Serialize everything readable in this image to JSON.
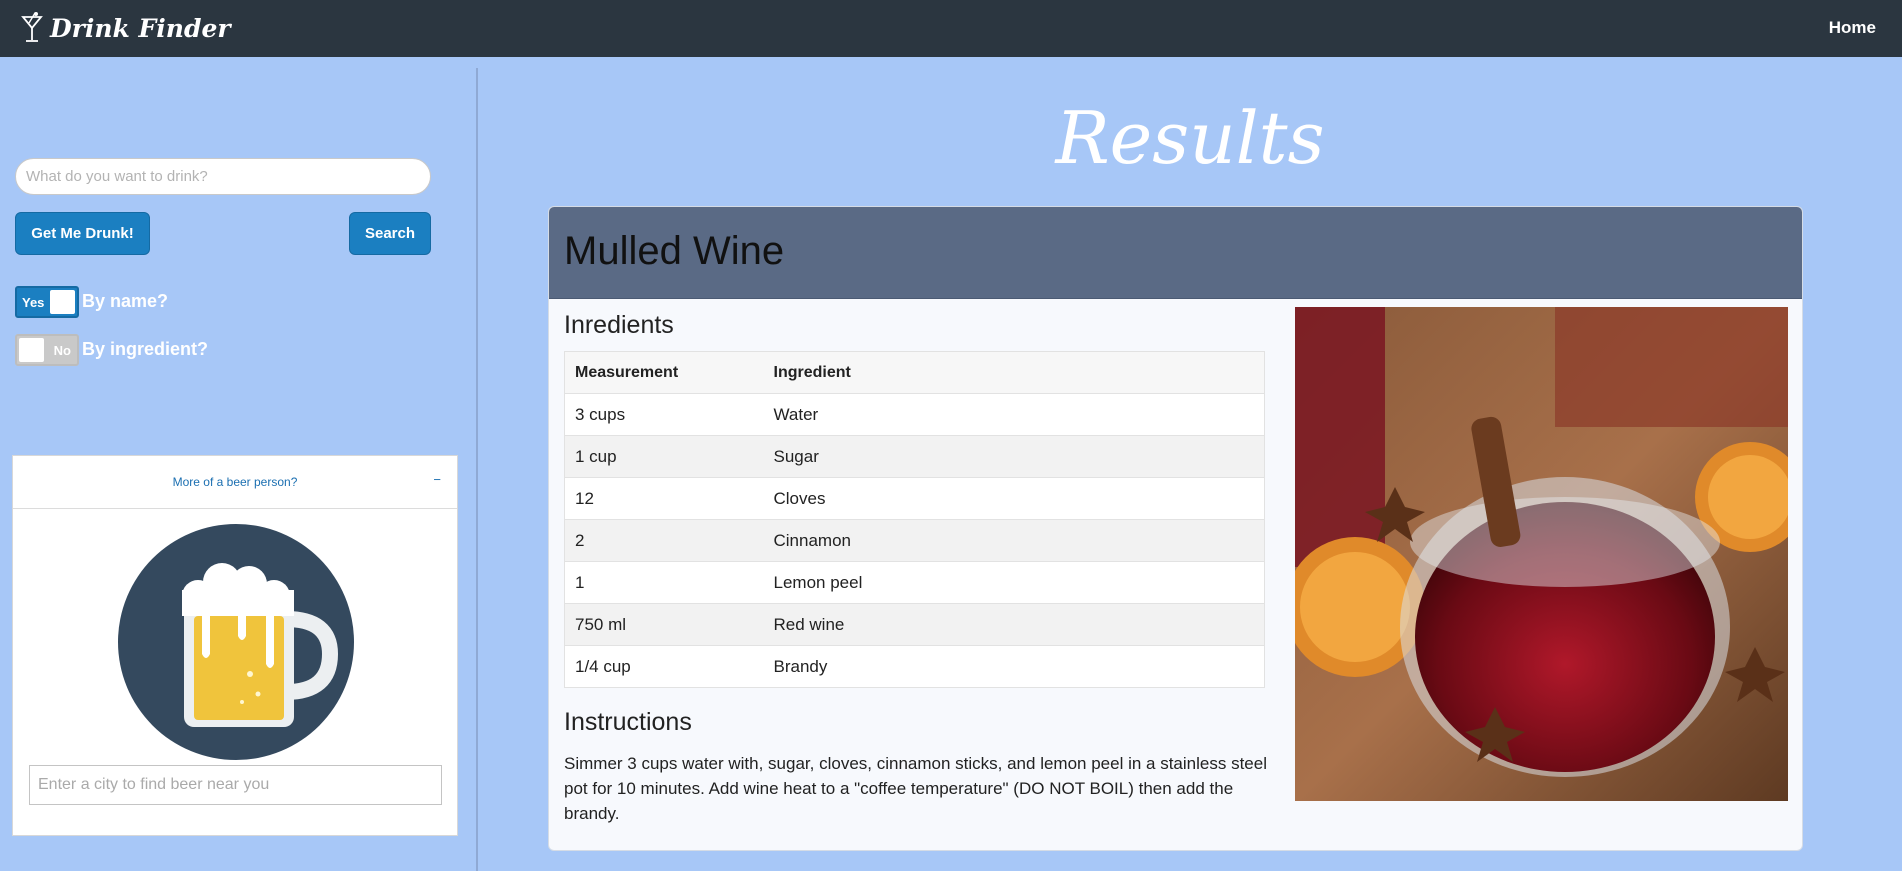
{
  "navbar": {
    "brand": "Drink Finder",
    "brand_icon": "cocktail-glass-icon",
    "home_label": "Home"
  },
  "sidebar": {
    "search_placeholder": "What do you want to drink?",
    "get_drunk_label": "Get Me Drunk!",
    "search_label": "Search",
    "toggles": [
      {
        "state": "Yes",
        "label": "By name?",
        "on": true
      },
      {
        "state": "No",
        "label": "By ingredient?",
        "on": false
      }
    ]
  },
  "beer_panel": {
    "header": "More of a beer person?",
    "collapse_symbol": "−",
    "city_placeholder": "Enter a city to find beer near you",
    "icon": "beer-mug-icon"
  },
  "main": {
    "page_title": "Results",
    "drink": {
      "name": "Mulled Wine",
      "ingredients_heading": "Inredients",
      "table_headers": [
        "Measurement",
        "Ingredient"
      ],
      "ingredients": [
        {
          "measurement": "3 cups",
          "ingredient": "Water"
        },
        {
          "measurement": "1 cup",
          "ingredient": "Sugar"
        },
        {
          "measurement": "12",
          "ingredient": "Cloves"
        },
        {
          "measurement": "2",
          "ingredient": "Cinnamon"
        },
        {
          "measurement": "1",
          "ingredient": "Lemon peel"
        },
        {
          "measurement": "750 ml",
          "ingredient": "Red wine"
        },
        {
          "measurement": "1/4 cup",
          "ingredient": "Brandy"
        }
      ],
      "instructions_heading": "Instructions",
      "instructions": "Simmer 3 cups water with, sugar, cloves, cinnamon sticks, and lemon peel in a stainless steel pot for 10 minutes. Add wine heat to a \"coffee temperature\" (DO NOT BOIL) then add the brandy."
    }
  },
  "colors": {
    "background": "#a7c7f7",
    "navbar": "#2b3640",
    "accent": "#1b7fc1",
    "card_header": "#5a6a85"
  }
}
